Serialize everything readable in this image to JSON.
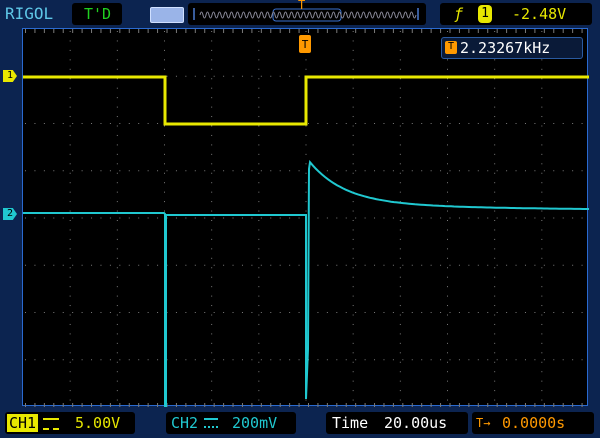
{
  "header": {
    "brand": "RIGOL",
    "run_status": "T'D",
    "trigger_edge_icon": "rising-edge-icon",
    "trigger_source": "1",
    "trigger_level": "-2.48V",
    "trigger_position_marker": "T"
  },
  "measurement": {
    "marker": "T",
    "frequency": "2.23267kHz"
  },
  "channels": [
    {
      "marker": "1",
      "label": "CH1",
      "coupling_icon": "dc-coupling-icon",
      "scale": "5.00V",
      "color": "#e8e800"
    },
    {
      "marker": "2",
      "label": "CH2",
      "coupling_icon": "dc-coupling-icon",
      "scale": "200mV",
      "color": "#20c8d0"
    }
  ],
  "footer": {
    "time_label": "Time",
    "time_scale": "20.00us",
    "trigger_offset_marker": "T→",
    "trigger_offset": "0.0000s"
  },
  "colors": {
    "background": "#0c2450",
    "grid": "#7a7a7a",
    "trigger": "#ff9900"
  }
}
